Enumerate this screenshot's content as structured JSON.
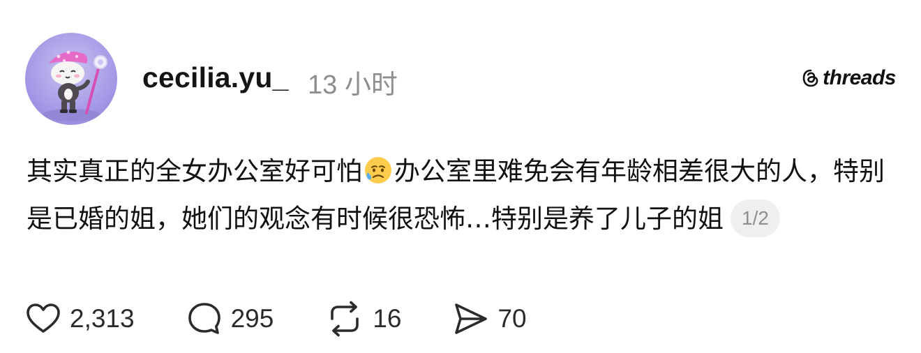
{
  "post": {
    "author": {
      "username": "cecilia.yu_",
      "avatar_icon": "avatar-cartoon-character"
    },
    "timestamp": "13 小时",
    "brand": {
      "text": "threads",
      "icon": "threads-logo-icon"
    },
    "body": {
      "text_part1": "其实真正的全女办公室好可怕",
      "emoji": "sad-but-relieved-face",
      "text_part2": "办公室里难免会有年龄相差很大的人，特别是已婚的姐，她们的观念有时候很恐怖…特别是养了儿子的姐"
    },
    "page_indicator": "1/2",
    "stats": {
      "likes": "2,313",
      "replies": "295",
      "reposts": "16",
      "shares": "70"
    }
  },
  "colors": {
    "text": "#111111",
    "muted": "#8e8e8e",
    "pill_bg": "#efefef",
    "avatar_bg": "#a79de8"
  }
}
